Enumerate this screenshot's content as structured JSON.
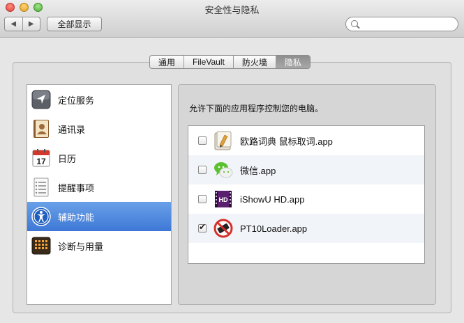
{
  "window": {
    "title": "安全性与隐私"
  },
  "toolbar": {
    "back_glyph": "◀",
    "forward_glyph": "▶",
    "show_all_label": "全部显示",
    "search_value": ""
  },
  "tabs": [
    {
      "label": "通用",
      "active": false
    },
    {
      "label": "FileVault",
      "active": false
    },
    {
      "label": "防火墙",
      "active": false
    },
    {
      "label": "隐私",
      "active": true
    }
  ],
  "sidebar": {
    "items": [
      {
        "label": "定位服务",
        "icon": "location-arrow-icon",
        "selected": false
      },
      {
        "label": "通讯录",
        "icon": "contacts-book-icon",
        "selected": false
      },
      {
        "label": "日历",
        "icon": "calendar-icon",
        "selected": false,
        "icon_text": "17"
      },
      {
        "label": "提醒事项",
        "icon": "reminders-list-icon",
        "selected": false
      },
      {
        "label": "辅助功能",
        "icon": "accessibility-icon",
        "selected": true
      },
      {
        "label": "诊断与用量",
        "icon": "diagnostics-grid-icon",
        "selected": false
      }
    ]
  },
  "main": {
    "prompt": "允许下面的应用程序控制您的电脑。",
    "apps": [
      {
        "name": "欧路词典 鼠标取词.app",
        "checked": false,
        "icon": "eudic-dictionary-icon"
      },
      {
        "name": "微信.app",
        "checked": false,
        "icon": "wechat-icon"
      },
      {
        "name": "iShowU HD.app",
        "checked": false,
        "icon": "ishowu-hd-icon",
        "icon_text": "HD"
      },
      {
        "name": "PT10Loader.app",
        "checked": true,
        "icon": "pt10loader-icon"
      }
    ]
  },
  "colors": {
    "selection_blue": "#3d78d6",
    "window_bg": "#e6e6e6"
  }
}
